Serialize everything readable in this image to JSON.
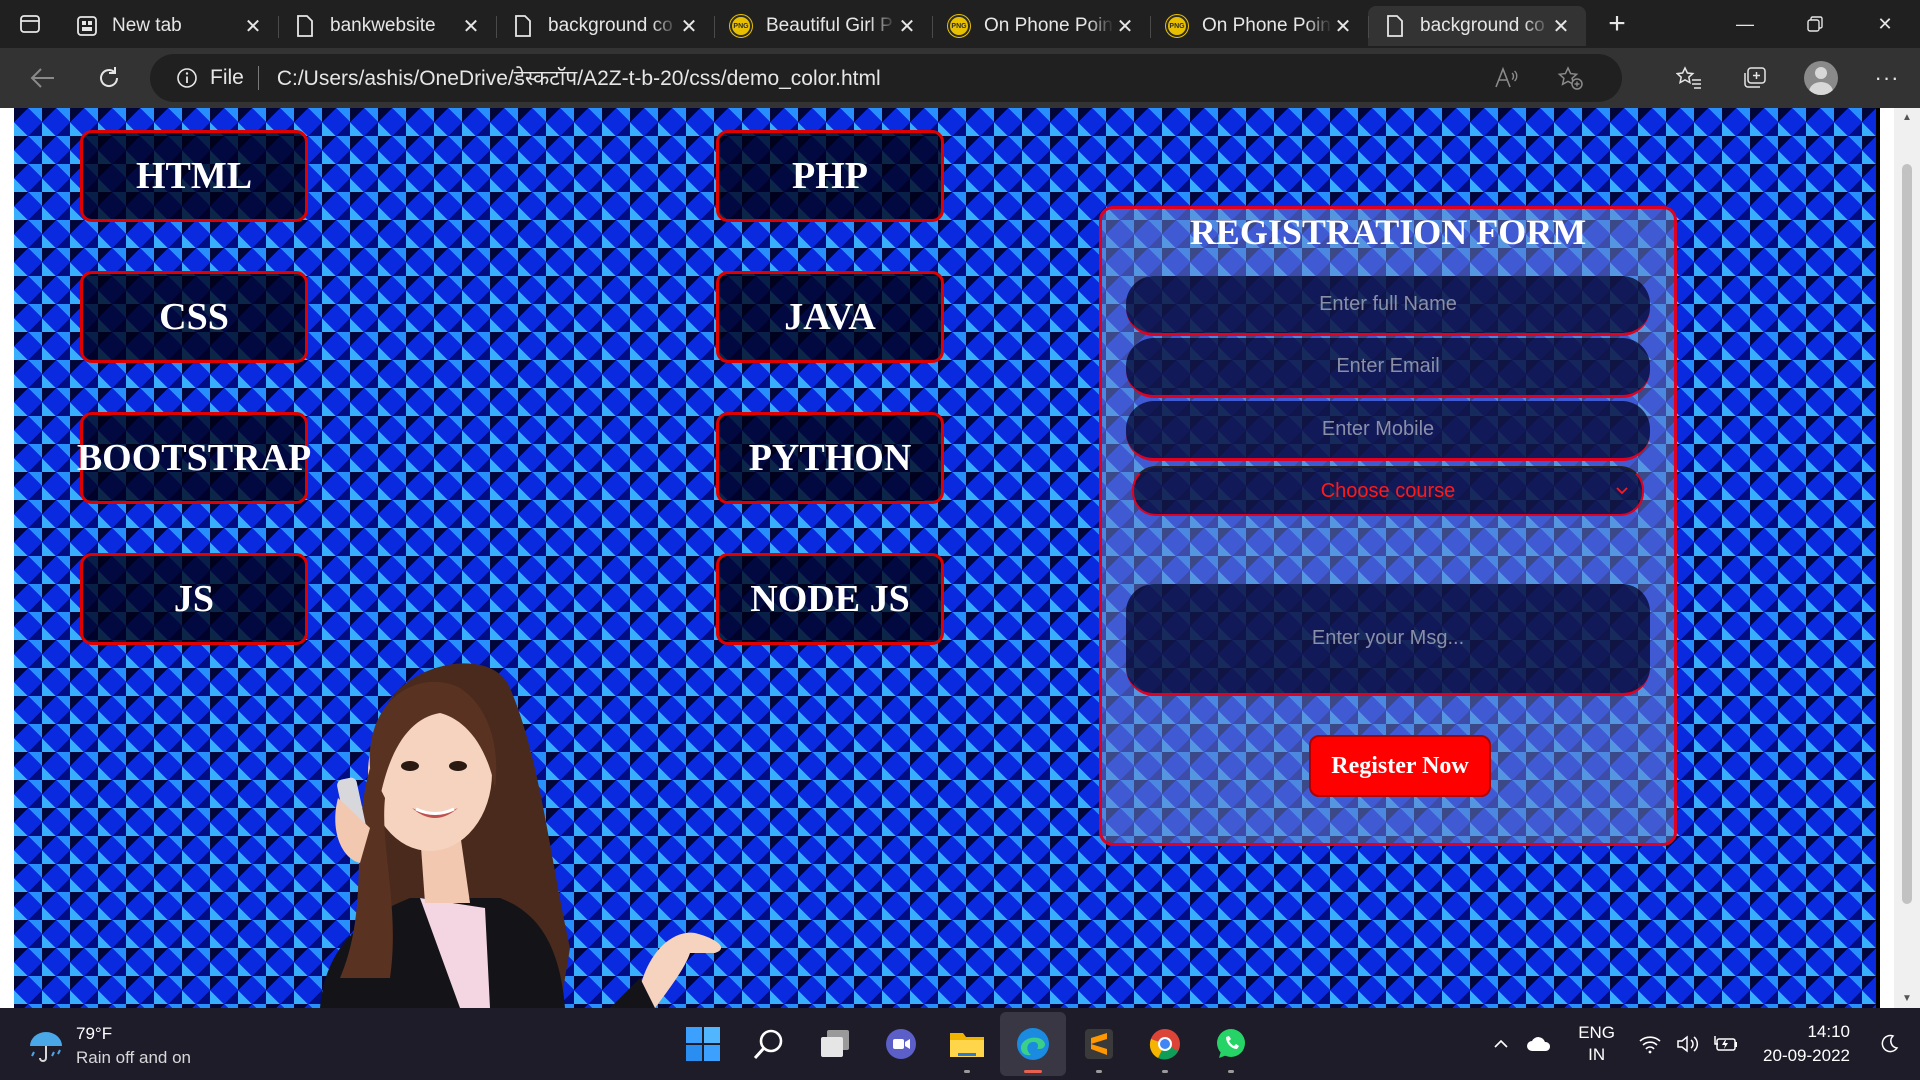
{
  "browser": {
    "tabs": [
      {
        "title": "New tab",
        "icon": "newtab-icon",
        "active": false
      },
      {
        "title": "bankwebsite",
        "icon": "page-icon",
        "active": false
      },
      {
        "title": "background co",
        "icon": "page-icon",
        "active": false
      },
      {
        "title": "Beautiful Girl P",
        "icon": "png-favicon",
        "active": false
      },
      {
        "title": "On Phone Poin",
        "icon": "png-favicon",
        "active": false
      },
      {
        "title": "On Phone Poin",
        "icon": "png-favicon",
        "active": false
      },
      {
        "title": "background co",
        "icon": "page-icon",
        "active": true
      }
    ],
    "address": {
      "scheme_label": "File",
      "url": "C:/Users/ashis/OneDrive/डेस्कटॉप/A2Z-t-b-20/css/demo_color.html"
    }
  },
  "page": {
    "courses_left": [
      "HTML",
      "CSS",
      "BOOTSTRAP",
      "JS"
    ],
    "courses_right": [
      "PHP",
      "JAVA",
      "PYTHON",
      "NODE JS"
    ],
    "form": {
      "title": "REGISTRATION FORM",
      "name_placeholder": "Enter full Name",
      "email_placeholder": "Enter Email",
      "mobile_placeholder": "Enter Mobile",
      "course_select": "Choose course",
      "msg_placeholder": "Enter your Msg...",
      "submit_label": "Register Now"
    },
    "colors": {
      "accent": "#ff0000",
      "border": "#e00020",
      "pattern": "#0a2ae0"
    }
  },
  "taskbar": {
    "weather": {
      "temp": "79°F",
      "desc": "Rain off and on"
    },
    "apps": [
      "start-icon",
      "search-icon",
      "task-view-icon",
      "teams-icon",
      "file-explorer-icon",
      "edge-icon",
      "sublime-icon",
      "chrome-icon",
      "whatsapp-icon"
    ],
    "lang": {
      "line1": "ENG",
      "line2": "IN"
    },
    "clock": {
      "time": "14:10",
      "date": "20-09-2022"
    }
  }
}
